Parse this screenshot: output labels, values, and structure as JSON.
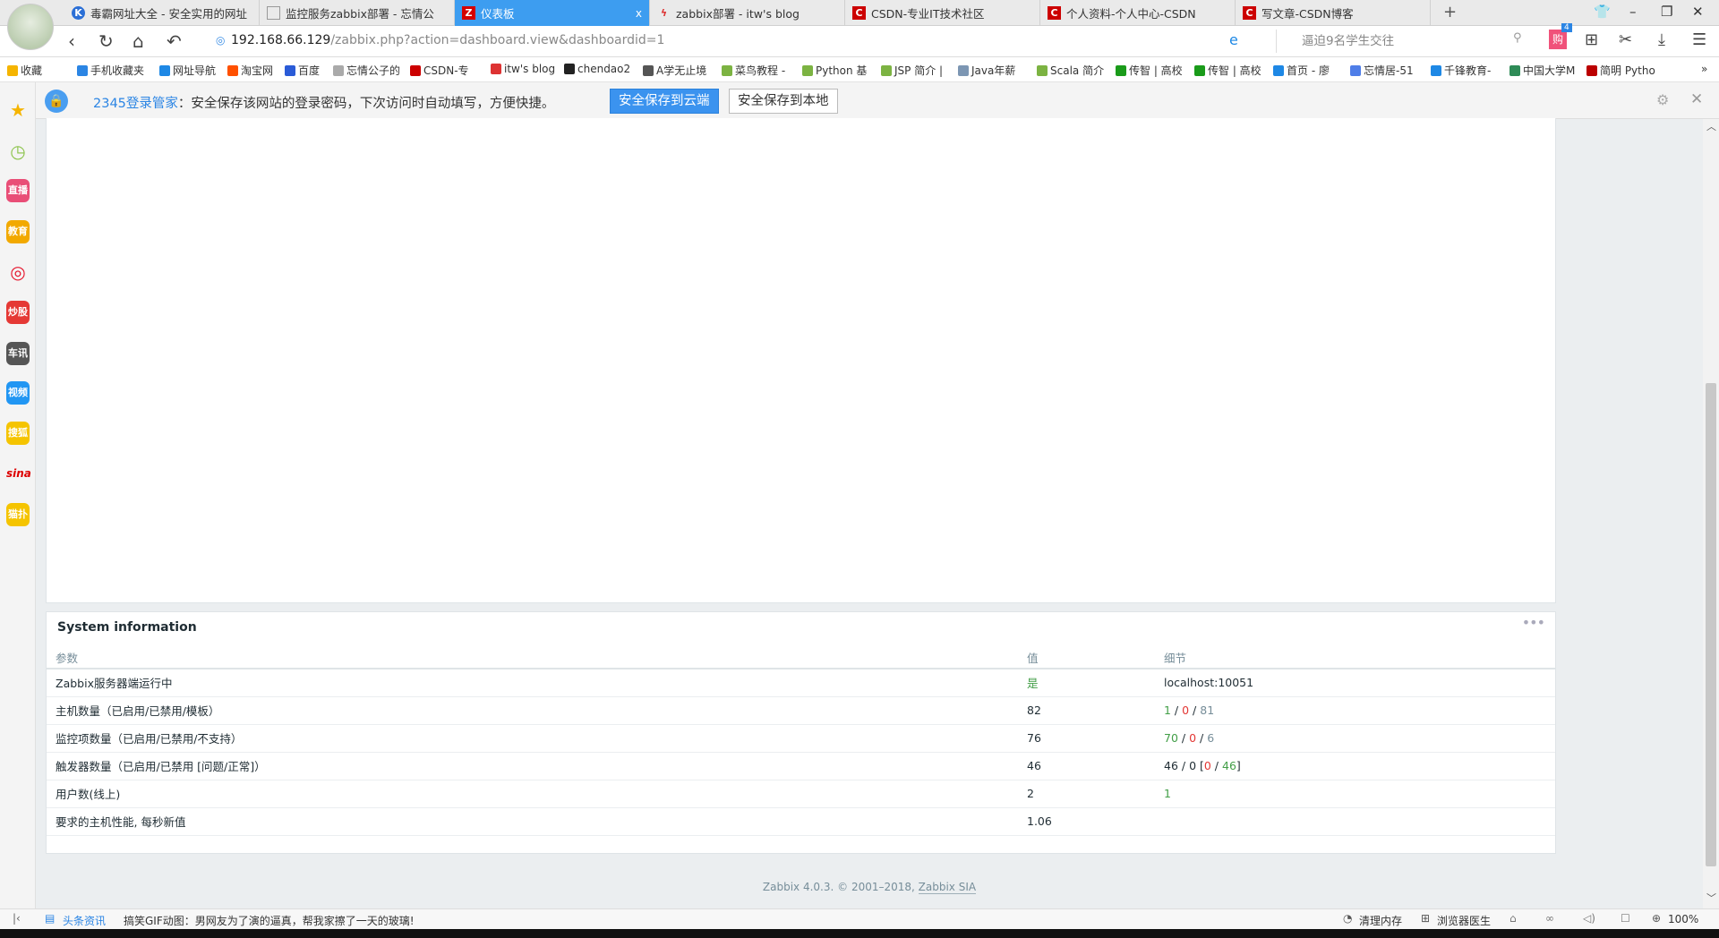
{
  "browser": {
    "tabs": [
      {
        "label": "毒霸网址大全 - 安全实用的网址",
        "icon": "k-logo-icon",
        "color": "#2b6fd6",
        "glyph": "K"
      },
      {
        "label": "监控服务zabbix部署 - 忘情公",
        "icon": "page-icon",
        "color": "#999",
        "glyph": ""
      },
      {
        "label": "仪表板",
        "icon": "zabbix-logo-icon",
        "color": "#d40000",
        "glyph": "Z",
        "active": true
      },
      {
        "label": "zabbix部署 - itw's blog",
        "icon": "bolt-icon",
        "color": "#d33",
        "glyph": "ϟ"
      },
      {
        "label": "CSDN-专业IT技术社区",
        "icon": "csdn-logo-icon",
        "color": "#c00",
        "glyph": "C"
      },
      {
        "label": "个人资料-个人中心-CSDN",
        "icon": "csdn-logo-icon",
        "color": "#c00",
        "glyph": "C"
      },
      {
        "label": "写文章-CSDN博客",
        "icon": "csdn-logo-icon",
        "color": "#c00",
        "glyph": "C"
      }
    ],
    "close_tab": "x",
    "new_tab": "+",
    "url_host": "192.168.66.129",
    "url_path": "/zabbix.php?action=dashboard.view&dashboardid=1",
    "search_placeholder": "逼迫9名学生交往",
    "cart_badge": "4",
    "bookmarks": [
      "收藏",
      "手机收藏夹",
      "网址导航",
      "淘宝网",
      "百度",
      "忘情公子的",
      "CSDN-专",
      "itw's blog",
      "chendao2",
      "A学无止境",
      "菜鸟教程 -",
      "Python 基",
      "JSP 简介 |",
      "Java年薪",
      "Scala 简介",
      "传智 | 高校",
      "传智 | 高校",
      "首页 - 廖",
      "忘情居-51",
      "千锋教育-",
      "中国大学M",
      "简明 Pytho"
    ],
    "bookmarks_more": "»"
  },
  "password_bar": {
    "brand": "2345登录管家",
    "message": "：安全保存该网站的登录密码，下次访问时自动填写，方便快捷。",
    "save_cloud": "安全保存到云端",
    "save_local": "安全保存到本地"
  },
  "sidebar": [
    {
      "name": "favorites",
      "label": "★",
      "color": "#f5b400"
    },
    {
      "name": "history",
      "label": "◷",
      "color": "#8bc34a"
    },
    {
      "name": "live",
      "label": "直播",
      "color": "#e94e77"
    },
    {
      "name": "education",
      "label": "教育",
      "color": "#f2a900"
    },
    {
      "name": "weibo",
      "label": "◎",
      "color": "#e6162d"
    },
    {
      "name": "stocks",
      "label": "炒股",
      "color": "#e53935"
    },
    {
      "name": "cars",
      "label": "车讯",
      "color": "#555"
    },
    {
      "name": "video",
      "label": "视频",
      "color": "#2196f3"
    },
    {
      "name": "sohu",
      "label": "搜狐",
      "color": "#f5c400"
    },
    {
      "name": "sina",
      "label": "sina",
      "color": "#d00"
    },
    {
      "name": "maopu",
      "label": "猫扑",
      "color": "#f5c400"
    }
  ],
  "system_info": {
    "title": "System information",
    "menu": "•••",
    "columns": [
      "参数",
      "值",
      "细节"
    ],
    "rows": [
      {
        "param": "Zabbix服务器端运行中",
        "value": "是",
        "details": [
          {
            "t": "localhost:10051",
            "c": ""
          }
        ]
      },
      {
        "param": "主机数量（已启用/已禁用/模板）",
        "value": "82",
        "details": [
          {
            "t": "1",
            "c": "g"
          },
          {
            "t": " / ",
            "c": ""
          },
          {
            "t": "0",
            "c": "r"
          },
          {
            "t": " / ",
            "c": ""
          },
          {
            "t": "81",
            "c": "gr"
          }
        ]
      },
      {
        "param": "监控项数量（已启用/已禁用/不支持）",
        "value": "76",
        "details": [
          {
            "t": "70",
            "c": "g"
          },
          {
            "t": " / ",
            "c": ""
          },
          {
            "t": "0",
            "c": "r"
          },
          {
            "t": " / ",
            "c": ""
          },
          {
            "t": "6",
            "c": "gr"
          }
        ]
      },
      {
        "param": "触发器数量（已启用/已禁用 [问题/正常]）",
        "value": "46",
        "details": [
          {
            "t": "46 / 0 [",
            "c": ""
          },
          {
            "t": "0",
            "c": "r"
          },
          {
            "t": " / ",
            "c": ""
          },
          {
            "t": "46",
            "c": "g"
          },
          {
            "t": "]",
            "c": ""
          }
        ]
      },
      {
        "param": "用户数(线上)",
        "value": "2",
        "details": [
          {
            "t": "1",
            "c": "g"
          }
        ]
      },
      {
        "param": "要求的主机性能, 每秒新值",
        "value": "1.06",
        "details": []
      }
    ]
  },
  "footer": {
    "text": "Zabbix 4.0.3. © 2001–2018, ",
    "link": "Zabbix SIA"
  },
  "statusbar": {
    "news_label": "头条资讯",
    "news_text": "搞笑GIF动图：男网友为了演的逼真，帮我家擦了一天的玻璃!",
    "clear_memory": "清理内存",
    "doctor": "浏览器医生",
    "zoom": "100%"
  }
}
